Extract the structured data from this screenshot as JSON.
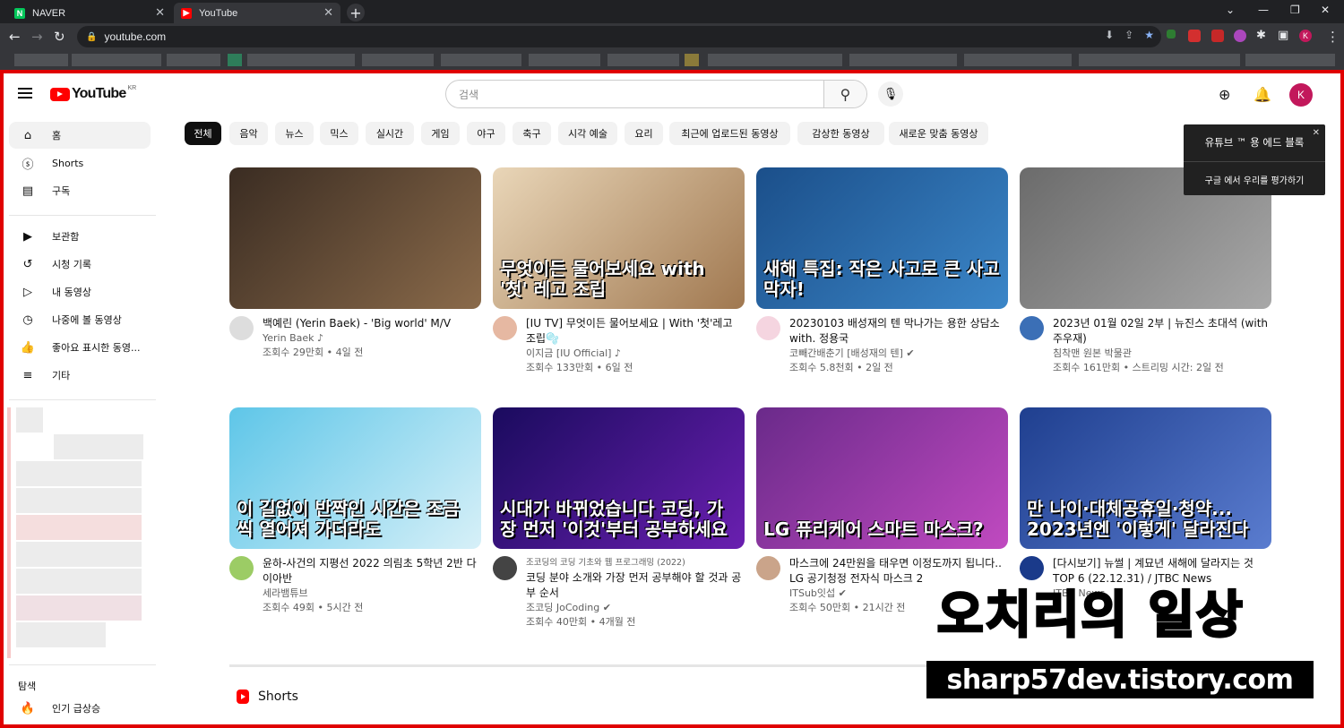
{
  "browser": {
    "tabs": [
      {
        "title": "NAVER",
        "favicon": "naver-icon",
        "active": false
      },
      {
        "title": "YouTube",
        "favicon": "youtube-icon",
        "active": true
      }
    ],
    "url": "youtube.com"
  },
  "header": {
    "logo_text": "YouTube",
    "logo_region": "KR",
    "search_placeholder": "검색",
    "avatar_letter": "K"
  },
  "sidebar": {
    "items": [
      {
        "label": "홈",
        "icon": "home-icon"
      },
      {
        "label": "Shorts",
        "icon": "shorts-icon"
      },
      {
        "label": "구독",
        "icon": "subscriptions-icon"
      },
      {
        "label": "보관함",
        "icon": "library-icon"
      },
      {
        "label": "시청 기록",
        "icon": "history-icon"
      },
      {
        "label": "내 동영상",
        "icon": "my-videos-icon"
      },
      {
        "label": "나중에 볼 동영상",
        "icon": "watch-later-icon"
      },
      {
        "label": "좋아요 표시한 동영...",
        "icon": "liked-icon"
      },
      {
        "label": "기타",
        "icon": "more-icon"
      }
    ],
    "explore_heading": "탐색",
    "explore_items": [
      {
        "label": "인기 급상승",
        "icon": "trending-icon"
      }
    ]
  },
  "chips": [
    "전체",
    "음악",
    "뉴스",
    "믹스",
    "실시간",
    "게임",
    "야구",
    "축구",
    "시각 예술",
    "요리",
    "최근에 업로드된 동영상",
    "감상한 동영상",
    "새로운 맞춤 동영상"
  ],
  "promo": {
    "title": "유튜브 ™ 용 에드 블록",
    "subtitle": "구글 에서 우리를 평가하기"
  },
  "videos": [
    {
      "title": "백예린 (Yerin Baek) - 'Big world' M/V",
      "channel": "Yerin Baek ♪",
      "stats": "조회수 29만회 • 4일 전",
      "thumb_caption": "",
      "thumb_colors": [
        "#3a2c22",
        "#8a6a4a"
      ],
      "avatar_color": "#dddddd"
    },
    {
      "title": "[IU TV] 무엇이든 물어보세요 | With '첫'레고 조립🫧",
      "channel": "이지금 [IU Official] ♪",
      "stats": "조회수 133만회 • 6일 전",
      "thumb_caption": "무엇이든 물어보세요 with '첫' 레고 조립",
      "thumb_colors": [
        "#e9d6b8",
        "#a07850"
      ],
      "avatar_color": "#e6b8a2"
    },
    {
      "title": "20230103 배성재의 텐 막나가는 용한 상담소 with. 정용국",
      "channel": "코빼간배춘기 [배성재의 텐] ✔",
      "stats": "조회수 5.8천회 • 2일 전",
      "thumb_caption": "새해 특집: 작은 사고로 큰 사고 막자!",
      "thumb_colors": [
        "#1b4f8a",
        "#3b86c8"
      ],
      "avatar_color": "#f5d5e0"
    },
    {
      "title": "2023년 01월 02일 2부 | 뉴진스 초대석 (with 주우재)",
      "channel": "침착맨 원본 박물관",
      "stats": "조회수 161만회 • 스트리밍 시간: 2일 전",
      "thumb_caption": "",
      "thumb_colors": [
        "#6b6b6b",
        "#a8a8a8"
      ],
      "avatar_color": "#3b6fb6"
    },
    {
      "title": "윤하-사건의 지평선 2022 의림초 5학년 2반 다이아반",
      "channel": "세라뱀튜브",
      "stats": "조회수 49회 • 5시간 전",
      "thumb_caption": "이 길없이 반짝인 시간은 조금씩 열어져 가더라도",
      "thumb_colors": [
        "#5ec6e8",
        "#d7f0f8"
      ],
      "avatar_color": "#9ccc65"
    },
    {
      "title": "코딩 분야 소개와 가장 먼저 공부해야 할 것과 공부 순서",
      "channel": "조코딩 JoCoding ✔",
      "stats": "조회수 40만회 • 4개월 전",
      "thumb_caption": "시대가 바뀌었습니다 코딩, 가장 먼저 '이것'부터 공부하세요",
      "thumb_colors": [
        "#1a0b5e",
        "#6a1fb0"
      ],
      "avatar_color": "#444444",
      "pre_title": "조코딩의 코딩 기초와 웹 프로그래밍 (2022)"
    },
    {
      "title": "마스크에 24만원을 태우면 이정도까지 됩니다.. LG 공기청정 전자식 마스크 2",
      "channel": "ITSub잇섭 ✔",
      "stats": "조회수 50만회 • 21시간 전",
      "thumb_caption": "LG 퓨리케어 스마트 마스크?",
      "thumb_colors": [
        "#6a2a8a",
        "#c04ac0"
      ],
      "avatar_color": "#caa48a"
    },
    {
      "title": "[다시보기] 뉴썰 | 계묘년 새해에 달라지는 것 TOP 6 (22.12.31) / JTBC News",
      "channel": "JTBC News",
      "stats": "",
      "thumb_caption": "만 나이·대체공휴일·청약... 2023년엔 '이렇게' 달라진다",
      "thumb_colors": [
        "#1f3f8f",
        "#5a7ccf"
      ],
      "avatar_color": "#1a3a8a"
    }
  ],
  "shorts_heading": "Shorts",
  "watermark": {
    "line1": "오치리의 일상",
    "line2": "sharp57dev.tistory.com"
  }
}
